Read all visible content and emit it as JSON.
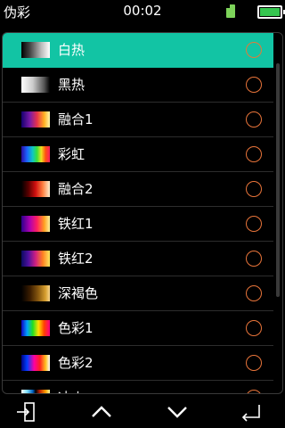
{
  "status": {
    "title": "伪彩",
    "time": "00:02",
    "sd_icon": "sd-card-icon",
    "battery_icon": "battery-icon",
    "battery_color": "#35c64f"
  },
  "palette_list": {
    "accent": "#12c4a4",
    "radio_color": "#e8743a",
    "selected_index": 0,
    "items": [
      {
        "label": "白热",
        "swatch": "white-hot"
      },
      {
        "label": "黑热",
        "swatch": "black-hot"
      },
      {
        "label": "融合1",
        "swatch": "fusion1"
      },
      {
        "label": "彩虹",
        "swatch": "rainbow"
      },
      {
        "label": "融合2",
        "swatch": "fusion2"
      },
      {
        "label": "铁红1",
        "swatch": "ironred1"
      },
      {
        "label": "铁红2",
        "swatch": "ironred2"
      },
      {
        "label": "深褐色",
        "swatch": "sepia"
      },
      {
        "label": "色彩1",
        "swatch": "color1"
      },
      {
        "label": "色彩2",
        "swatch": "color2"
      },
      {
        "label": "冰火",
        "swatch": "icefire"
      }
    ]
  },
  "nav": {
    "exit_icon": "exit-icon",
    "up_icon": "chevron-up-icon",
    "down_icon": "chevron-down-icon",
    "back_icon": "back-icon"
  }
}
